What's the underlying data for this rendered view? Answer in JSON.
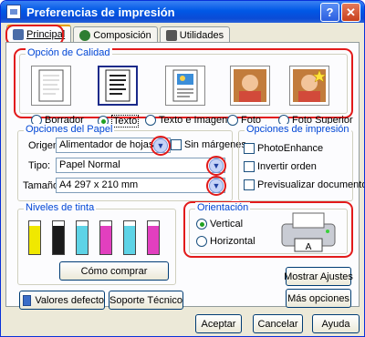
{
  "window": {
    "title": "Preferencias de impresión",
    "help": "?",
    "close": "✕"
  },
  "tabs": [
    {
      "label": "Principal",
      "active": true,
      "icon": "printer-icon"
    },
    {
      "label": "Composición",
      "active": false,
      "icon": "layout-icon"
    },
    {
      "label": "Utilidades",
      "active": false,
      "icon": "tools-icon"
    }
  ],
  "quality": {
    "title": "Opción de Calidad",
    "options": [
      {
        "label": "Borrador",
        "selected": false,
        "icon": "draft-icon"
      },
      {
        "label": "Texto",
        "selected": true,
        "icon": "text-icon"
      },
      {
        "label": "Texto e Imagen",
        "selected": false,
        "icon": "text-image-icon"
      },
      {
        "label": "Foto",
        "selected": false,
        "icon": "photo-icon"
      },
      {
        "label": "Foto Superior",
        "selected": false,
        "icon": "photo-best-icon"
      }
    ]
  },
  "paper": {
    "title": "Opciones del Papel",
    "origin_label": "Origen:",
    "origin_value": "Alimentador de hojas",
    "borderless_label": "Sin márgenes",
    "type_label": "Tipo:",
    "type_value": "Papel Normal",
    "size_label": "Tamaño:",
    "size_value": "A4 297 x 210 mm"
  },
  "print_options": {
    "title": "Opciones de impresión",
    "photoenhance": "PhotoEnhance",
    "reverse": "Invertir orden",
    "preview": "Previsualizar documento"
  },
  "ink": {
    "title": "Niveles de tinta",
    "levels": [
      {
        "color": "#f0e800",
        "level": 0.85
      },
      {
        "color": "#1a1a1a",
        "level": 0.85
      },
      {
        "color": "#5ed3e6",
        "level": 0.85
      },
      {
        "color": "#e23fbf",
        "level": 0.85
      },
      {
        "color": "#5ed3e6",
        "level": 0.85
      },
      {
        "color": "#e23fbf",
        "level": 0.85
      }
    ],
    "buy_label": "Cómo comprar"
  },
  "orientation": {
    "title": "Orientación",
    "vertical": "Vertical",
    "horizontal": "Horizontal",
    "selected": "vertical"
  },
  "buttons": {
    "show_settings": "Mostrar Ajustes",
    "defaults": "Valores defecto",
    "support": "Soporte Técnico",
    "more_options": "Más opciones",
    "ok": "Aceptar",
    "cancel": "Cancelar",
    "help": "Ayuda"
  },
  "colors": {
    "highlight": "#e21a1a",
    "group_title": "#0046d5",
    "selected_radio": "#21a121"
  }
}
